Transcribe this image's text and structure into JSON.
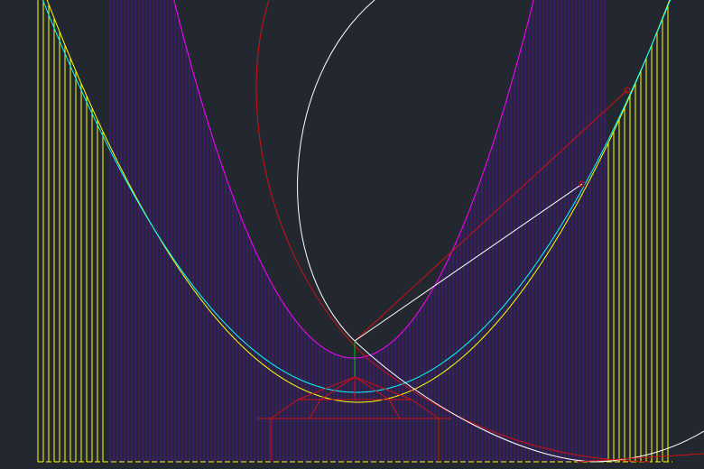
{
  "canvas": {
    "background": "#232830"
  },
  "colors": {
    "yellow": "#ffff00",
    "cyan": "#00ffff",
    "magenta": "#ff00ff",
    "purple": "#5a10a8",
    "red": "#d01010",
    "white": "#ffffff",
    "green": "#00c000"
  },
  "icons": [
    "handle-circle-icon"
  ]
}
